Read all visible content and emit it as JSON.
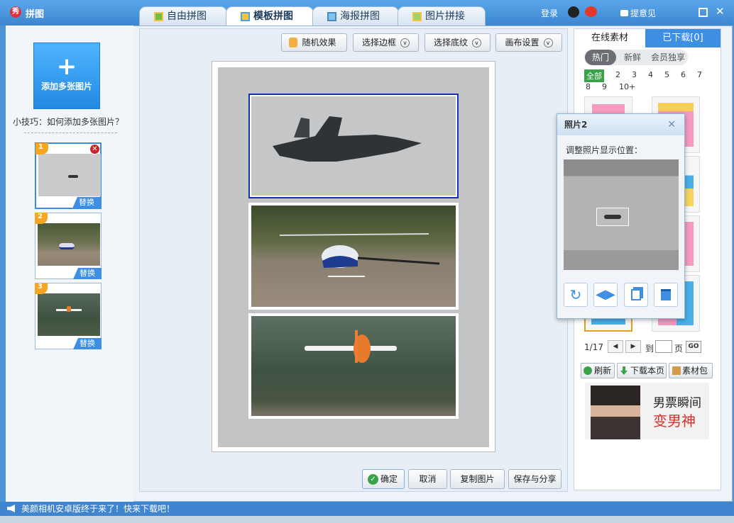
{
  "app": {
    "logo": "秀",
    "title": "拼图"
  },
  "tabs": [
    {
      "label": "自由拼图"
    },
    {
      "label": "模板拼图"
    },
    {
      "label": "海报拼图"
    },
    {
      "label": "图片拼接"
    }
  ],
  "header": {
    "login": "登录",
    "feedback": "提意见"
  },
  "left": {
    "add_label": "添加多张图片",
    "tip": "小技巧：如何添加多张图片？",
    "replace": "替换",
    "thumbs": [
      {
        "num": "1"
      },
      {
        "num": "2"
      },
      {
        "num": "3"
      }
    ]
  },
  "toolbar": {
    "random": "随机效果",
    "border": "选择边框",
    "texture": "选择底纹",
    "canvas": "画布设置"
  },
  "bottom": {
    "confirm": "确定",
    "cancel": "取消",
    "copy": "复制图片",
    "save": "保存与分享"
  },
  "right": {
    "tab_online": "在线素材",
    "tab_downloaded": "已下载[0]",
    "filters": [
      "热门",
      "新鲜",
      "会员独享"
    ],
    "nums": [
      "全部",
      "2",
      "3",
      "4",
      "5",
      "6",
      "7",
      "8",
      "9",
      "10+"
    ],
    "page": "1/17",
    "to": "到",
    "page_unit": "页",
    "go": "GO",
    "refresh": "刷新",
    "download_page": "下载本页",
    "pack": "素材包",
    "ad_line1": "男票瞬间",
    "ad_line2": "变男神"
  },
  "popup": {
    "title": "照片2",
    "label": "调整照片显示位置："
  },
  "status": {
    "message": "美颜相机安卓版终于来了！快来下载吧！"
  },
  "colors": {
    "accent": "#3c8fe3",
    "titlebar": "#4c93d9",
    "ad_red": "#d8302a"
  },
  "icons": [
    "plus-icon",
    "close-icon",
    "rotate-icon",
    "flip-icon",
    "copy-icon",
    "trash-icon",
    "speaker-icon",
    "qq-icon",
    "weibo-icon",
    "chevron-down-icon"
  ]
}
